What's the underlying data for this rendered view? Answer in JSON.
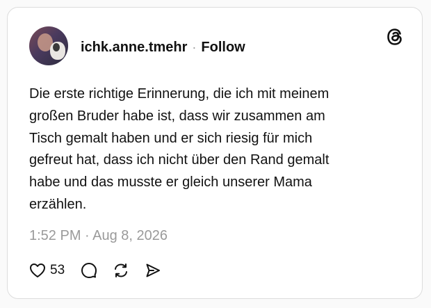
{
  "post": {
    "username": "ichk.anne.tmehr",
    "separator": "·",
    "follow_label": "Follow",
    "text_lines": [
      "Die erste richtige Erinnerung, die ich mit meinem",
      "großen Bruder habe ist, dass wir zusammen am",
      "Tisch gemalt haben und er sich riesig für mich",
      "gefreut hat, dass ich nicht über den Rand gemalt",
      "habe und das musste er gleich unserer Mama",
      "erzählen."
    ],
    "timestamp": "1:52 PM · Aug 8, 2026",
    "like_count": "53"
  },
  "icons": {
    "brand": "threads-logo-icon",
    "like": "heart-icon",
    "reply": "comment-icon",
    "repost": "repost-icon",
    "share": "send-icon"
  },
  "colors": {
    "text": "#111111",
    "muted": "#9a9a9a",
    "border": "#dcdcdc",
    "background": "#ffffff"
  }
}
